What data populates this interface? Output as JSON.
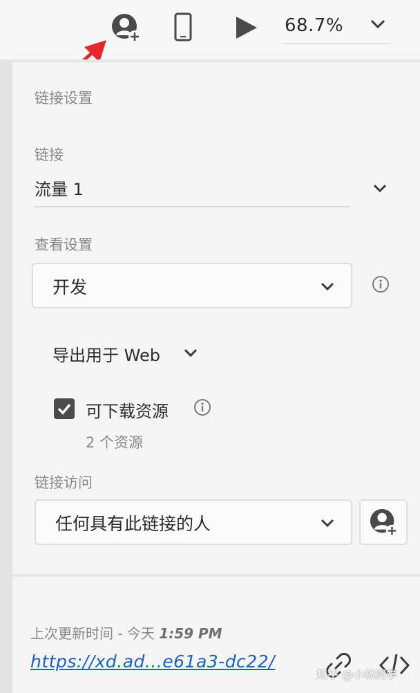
{
  "toolbar": {
    "icons": [
      "invite-user-icon",
      "mobile-device-icon",
      "play-icon",
      "chevron-down-icon"
    ],
    "zoom_level": "68.7%"
  },
  "panel": {
    "section_title": "链接设置",
    "link": {
      "label": "链接",
      "value": "流量 1"
    },
    "view_settings": {
      "label": "查看设置",
      "selected": "开发"
    },
    "export": {
      "label": "导出用于 Web"
    },
    "downloadable_assets": {
      "label": "可下载资源",
      "checked": true,
      "count_text": "2 个资源"
    },
    "link_access": {
      "label": "链接访问",
      "selected": "任何具有此链接的人"
    },
    "updated": {
      "prefix": "上次更新时间 - 今天",
      "time": "1:59 PM"
    },
    "url": "https://xd.ad...e61a3-dc22/"
  },
  "watermark": "知乎 @小标同学",
  "colors": {
    "accent_link": "#1f5fc4",
    "annotation_arrow": "#e8272b",
    "checkbox": "#4b4b4b"
  }
}
